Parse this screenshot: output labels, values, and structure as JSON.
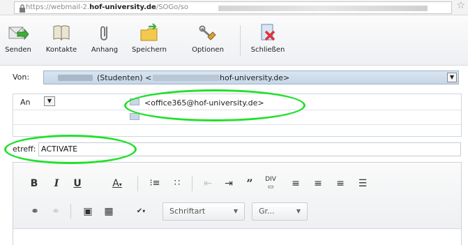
{
  "browser": {
    "url_prefix": "https://webmail-2.",
    "url_domain": "hof-university.de",
    "url_path": "/SOGo/so"
  },
  "toolbar": {
    "items": [
      {
        "label": "Senden",
        "icon": "send-icon"
      },
      {
        "label": "Kontakte",
        "icon": "contacts-icon"
      },
      {
        "label": "Anhang",
        "icon": "attachment-icon"
      },
      {
        "label": "Speichern",
        "icon": "save-icon"
      },
      {
        "label": "Optionen",
        "icon": "options-icon"
      },
      {
        "label": "Schließen",
        "icon": "close-icon"
      }
    ]
  },
  "compose": {
    "from_label": "Von:",
    "from_value_visible": "(Studenten) <",
    "from_domain": "hof-university.de>",
    "to_type": "An",
    "to_address": "<office365@hof-university.de>",
    "subject_label": "etreff:",
    "subject_value": "ACTIVATE"
  },
  "editor": {
    "font_combo": "Schriftart",
    "size_combo": "Gr..."
  },
  "colors": {
    "highlight": "#22e02c",
    "from_bg": "#d0dce9"
  }
}
